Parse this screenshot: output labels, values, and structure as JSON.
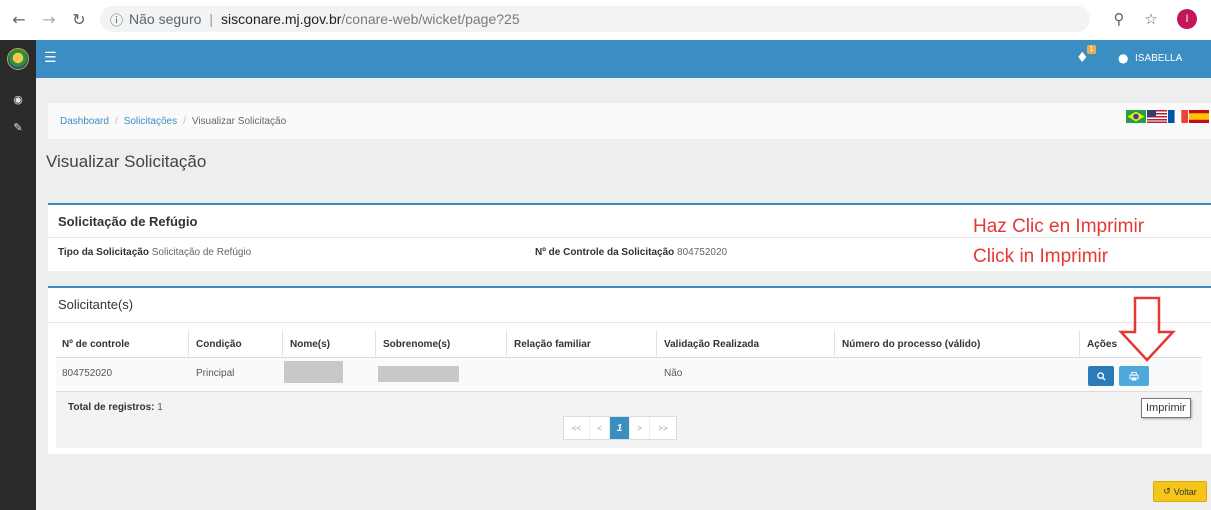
{
  "browser": {
    "security": "Não seguro",
    "url_host": "sisconare.mj.gov.br",
    "url_path": "/conare-web/wicket/page?25",
    "profile_initial": "I"
  },
  "header": {
    "notification_count": "1",
    "user_name": "ISABELLA"
  },
  "breadcrumb": {
    "items": [
      "Dashboard",
      "Solicitações",
      "Visualizar Solicitação"
    ]
  },
  "page": {
    "title": "Visualizar Solicitação"
  },
  "request_panel": {
    "title": "Solicitação de Refúgio",
    "type_label": "Tipo da Solicitação",
    "type_value": "Solicitação de Refúgio",
    "control_label": "Nº de Controle da Solicitação",
    "control_value": "804752020"
  },
  "applicants_panel": {
    "title": "Solicitante(s)",
    "columns": [
      "Nº de controle",
      "Condição",
      "Nome(s)",
      "Sobrenome(s)",
      "Relação familiar",
      "Validação Realizada",
      "Número do processo (válido)",
      "Ações"
    ],
    "rows": [
      {
        "control": "804752020",
        "condition": "Principal",
        "names": "",
        "surnames": "",
        "relation": "",
        "validation": "Não",
        "process": ""
      }
    ],
    "total_label": "Total de registros:",
    "total_value": "1"
  },
  "pagination": {
    "first": "<<",
    "prev": "<",
    "current": "1",
    "next": ">",
    "last": ">>"
  },
  "tooltip": "Imprimir",
  "annotation": {
    "line1": "Haz Clic en Imprimir",
    "line2": "Click in Imprimir"
  },
  "footer": {
    "back_label": "Voltar"
  },
  "colors": {
    "primary": "#3b8ec2",
    "sidebar": "#2a2a2a",
    "annotation": "#e53935",
    "back_button": "#f5c518",
    "view_button": "#2b7bb8",
    "print_button": "#4fa9db"
  }
}
